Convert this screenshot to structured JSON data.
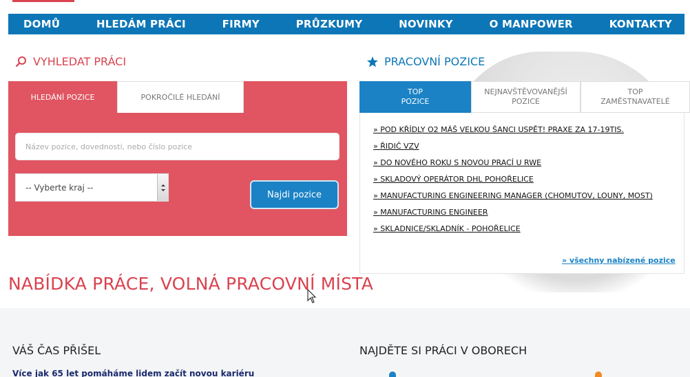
{
  "nav": {
    "items": [
      "DOMŮ",
      "HLEDÁM PRÁCI",
      "FIRMY",
      "PRŮZKUMY",
      "NOVINKY",
      "O MANPOWER",
      "KONTAKTY"
    ]
  },
  "search": {
    "heading": "VYHLEDAT PRÁCI",
    "tabs": [
      "HLEDÁNÍ POZICE",
      "POKROČILÉ HLEDÁNÍ"
    ],
    "input_placeholder": "Název pozice, dovednosti, nebo číslo pozice",
    "region_select": "-- Vyberte kraj --",
    "find_button": "Najdi pozice"
  },
  "positions": {
    "heading": "PRACOVNÍ POZICE",
    "tabs": [
      {
        "line1": "TOP",
        "line2": "POZICE"
      },
      {
        "line1": "NEJNAVŠTĚVOVANĚJŠÍ",
        "line2": "POZICE"
      },
      {
        "line1": "TOP",
        "line2": "ZAMĚSTNAVATELÉ"
      }
    ],
    "jobs": [
      "» POD KŘÍDLY O2 MÁŠ VELKOU ŠANCI USPĚT! PRAXE ZA 17-19TIS.",
      "» ŘIDIČ VZV",
      "» DO NOVÉHO ROKU S NOVOU PRACÍ U RWE",
      "» SKLADOVÝ OPERÁTOR DHL POHOŘELICE",
      "» MANUFACTURING ENGINEERING MANAGER (CHOMUTOV, LOUNY, MOST)",
      "» MANUFACTURING ENGINEER",
      "» SKLADNICE/SKLADNÍK - POHOŘELICE"
    ],
    "all_link": "» všechny nabízené pozice"
  },
  "main_title": "NABÍDKA PRÁCE, VOLNÁ PRACOVNÍ MÍSTA",
  "bottom": {
    "left_heading": "VÁŠ ČAS PŘIŠEL",
    "left_text": "Více jak 65 let pomáháme lidem začít novou kariéru",
    "right_heading": "NAJDĚTE SI PRÁCI V OBORECH"
  },
  "colors": {
    "nav_blue": "#0d76b7",
    "accent_red": "#d9434f",
    "search_bg": "#e05561",
    "button_blue": "#1b82c5"
  },
  "icons": [
    "search-icon",
    "star-icon",
    "dropdown-arrow-icon",
    "mouse-cursor-icon"
  ]
}
